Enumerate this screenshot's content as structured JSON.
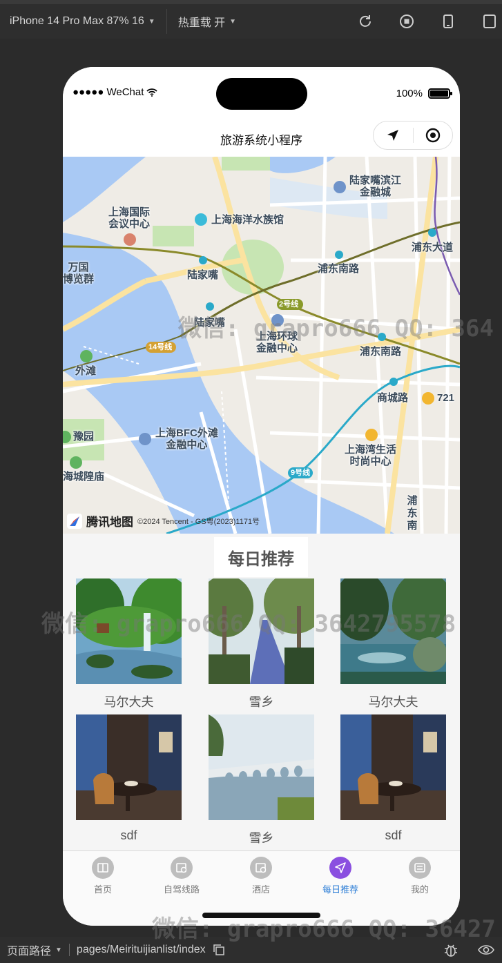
{
  "devtools": {
    "device_label": "iPhone 14 Pro Max 87% 16",
    "hot_reload_label": "热重载 开",
    "page_path_label": "页面路径",
    "page_path": "pages/Meirituijianlist/index"
  },
  "statusbar": {
    "carrier": "●●●●● WeChat",
    "battery_text": "100%"
  },
  "navbar": {
    "title": "旅游系统小程序"
  },
  "map": {
    "brand": "腾讯地图",
    "copyright": "©2024 Tencent - GS粤(2023)1171号",
    "labels": {
      "l1": "陆家嘴滨江\n金融城",
      "l2": "上海国际\n会议中心",
      "l3": "上海海洋水族馆",
      "l4": "浦东大道",
      "l5": "万国\n博览群",
      "l6": "陆家嘴",
      "l7": "浦东南路",
      "l8": "陆家嘴",
      "l9": "上海环球\n金融中心",
      "l10": "浦东南路",
      "l11": "外滩",
      "l12": "商城路",
      "l13": "721",
      "l14": "豫园",
      "l15": "上海BFC外滩\n金融中心",
      "l16": "上海湾生活\n时尚中心",
      "l17": "海城隍庙",
      "l18": "2号线",
      "l19": "14号线",
      "l20": "9号线",
      "l21": "浦东南"
    }
  },
  "section": {
    "title": "每日推荐"
  },
  "recommendations": [
    {
      "name": "马尔大夫"
    },
    {
      "name": "雪乡"
    },
    {
      "name": "马尔大夫"
    },
    {
      "name": "sdf"
    },
    {
      "name": "雪乡"
    },
    {
      "name": "sdf"
    }
  ],
  "tabbar": {
    "items": [
      {
        "label": "首页"
      },
      {
        "label": "自驾线路"
      },
      {
        "label": "酒店"
      },
      {
        "label": "每日推荐"
      },
      {
        "label": "我的"
      }
    ],
    "active_index": 3,
    "active_color": "#2c7dd6",
    "active_icon_bg": "#8a4fe0"
  },
  "watermarks": {
    "w1": "微信: grapro666 QQ: 364",
    "w2": "微信: grapro666 QQ: 3642795578",
    "w3": "微信: grapro666 QQ: 36427"
  }
}
